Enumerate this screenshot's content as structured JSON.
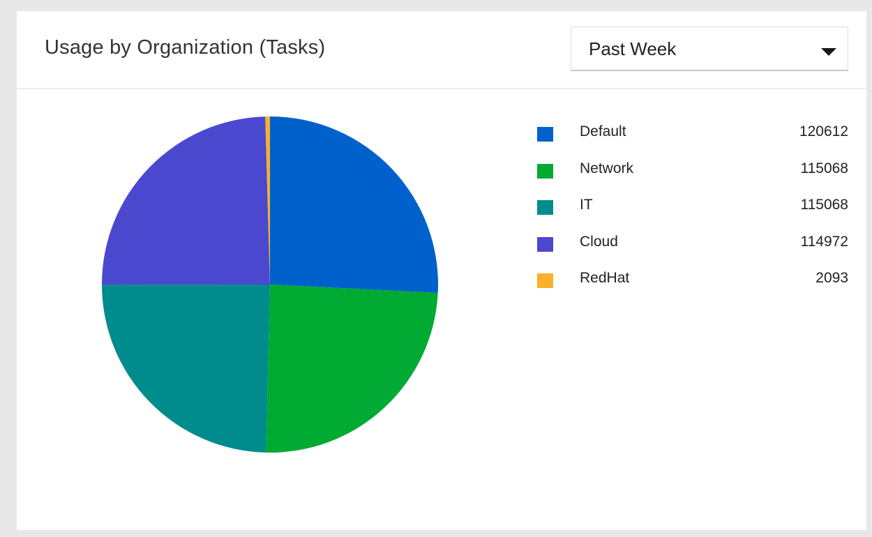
{
  "card": {
    "title": "Usage by Organization (Tasks)",
    "period_dropdown": {
      "selected": "Past Week",
      "icon": "caret-down-icon"
    }
  },
  "chart_data": {
    "type": "pie",
    "title": "",
    "slices": [
      {
        "label": "Default",
        "value": 120612,
        "value_label": "120612",
        "color": "#0061cc"
      },
      {
        "label": "Network",
        "value": 115068,
        "value_label": "115068",
        "color": "#00aa33"
      },
      {
        "label": "IT",
        "value": 115068,
        "value_label": "115068",
        "color": "#008c8c"
      },
      {
        "label": "Cloud",
        "value": 114972,
        "value_label": "114972",
        "color": "#4b48d0"
      },
      {
        "label": "RedHat",
        "value": 2093,
        "value_label": "2093",
        "color": "#f8b12c"
      }
    ],
    "legend_position": "right",
    "start": "top",
    "direction": "clockwise"
  }
}
